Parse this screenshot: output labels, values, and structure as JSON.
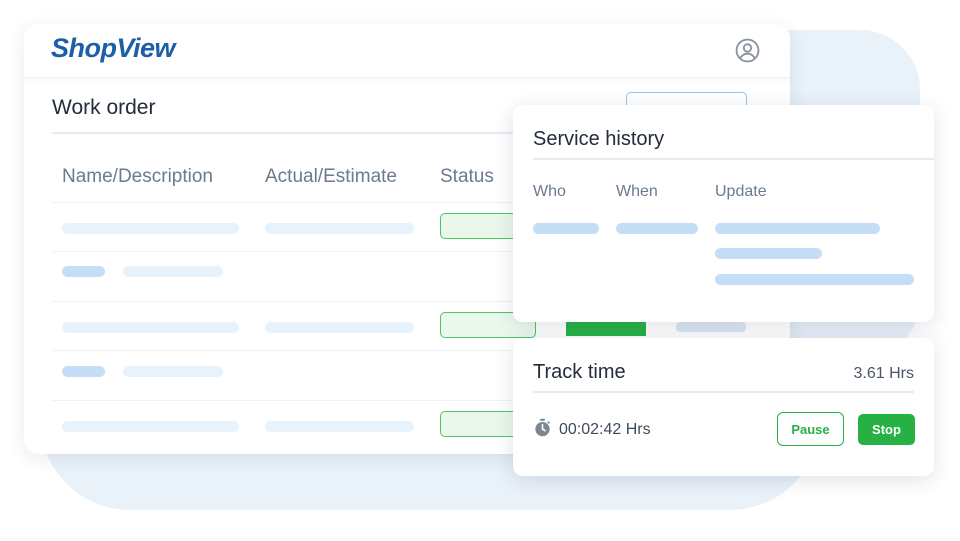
{
  "app": {
    "logo_text": "ShopView",
    "user_icon": "user-circle-icon"
  },
  "work_order": {
    "title": "Work order",
    "columns": [
      "Name/Description",
      "Actual/Estimate",
      "Status"
    ]
  },
  "service_history": {
    "title": "Service history",
    "columns": [
      "Who",
      "When",
      "Update"
    ]
  },
  "track_time": {
    "title": "Track time",
    "total": "3.61 Hrs",
    "timer_icon": "stopwatch-icon",
    "timer_value": "00:02:42 Hrs",
    "pause_label": "Pause",
    "stop_label": "Stop"
  },
  "colors": {
    "brand": "#1d5fa7",
    "accent_green": "#27b144",
    "placeholder": "#e6f2fc",
    "placeholder_dark": "#c3def6"
  }
}
